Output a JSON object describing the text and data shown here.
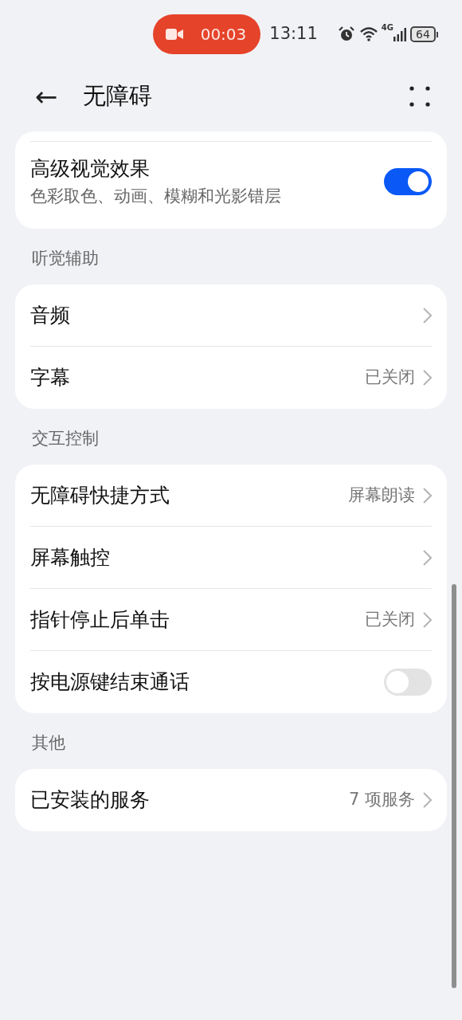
{
  "status_bar": {
    "recording_time": "00:03",
    "time": "13:11",
    "network": "4G",
    "battery": "64"
  },
  "header": {
    "back": "←",
    "title": "无障碍"
  },
  "sections": [
    {
      "rows": [
        {
          "kind": "toggle",
          "title": "高级视觉效果",
          "subtitle": "色彩取色、动画、模糊和光影错层",
          "on": true
        }
      ]
    },
    {
      "title": "听觉辅助",
      "rows": [
        {
          "kind": "link",
          "title": "音频"
        },
        {
          "kind": "link",
          "title": "字幕",
          "value": "已关闭"
        }
      ]
    },
    {
      "title": "交互控制",
      "rows": [
        {
          "kind": "link",
          "title": "无障碍快捷方式",
          "value": "屏幕朗读"
        },
        {
          "kind": "link",
          "title": "屏幕触控"
        },
        {
          "kind": "link",
          "title": "指针停止后单击",
          "value": "已关闭"
        },
        {
          "kind": "toggle",
          "title": "按电源键结束通话",
          "on": false
        }
      ]
    },
    {
      "title": "其他",
      "rows": [
        {
          "kind": "link",
          "title": "已安装的服务",
          "value": "7 项服务"
        }
      ]
    }
  ]
}
